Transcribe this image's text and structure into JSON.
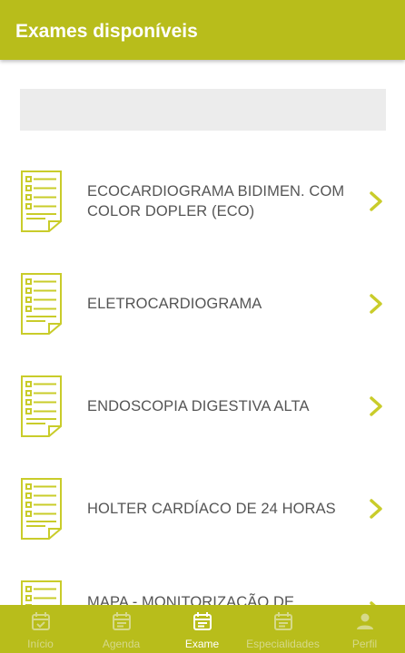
{
  "header": {
    "title": "Exames disponíveis"
  },
  "search": {
    "placeholder": ""
  },
  "exams": [
    {
      "label": "ECOCARDIOGRAMA BIDIMEN. COM COLOR DOPLER (ECO)"
    },
    {
      "label": "ELETROCARDIOGRAMA"
    },
    {
      "label": "ENDOSCOPIA DIGESTIVA ALTA"
    },
    {
      "label": "HOLTER CARDÍACO DE 24 HORAS"
    },
    {
      "label": "MAPA - MONITORIZAÇÃO DE"
    }
  ],
  "bottom_nav": {
    "items": [
      {
        "label": "Início",
        "icon": "calendar-check-icon",
        "active": false
      },
      {
        "label": "Agenda",
        "icon": "calendar-icon",
        "active": false
      },
      {
        "label": "Exame",
        "icon": "calendar-icon",
        "active": true
      },
      {
        "label": "Especialidades",
        "icon": "calendar-icon",
        "active": false
      },
      {
        "label": "Perfil",
        "icon": "person-icon",
        "active": false
      }
    ]
  },
  "colors": {
    "accent": "#b8bd1b",
    "icon": "#c9cc2a",
    "text": "#555555",
    "nav_inactive": "#d6d98a",
    "nav_active": "#ffffff"
  }
}
